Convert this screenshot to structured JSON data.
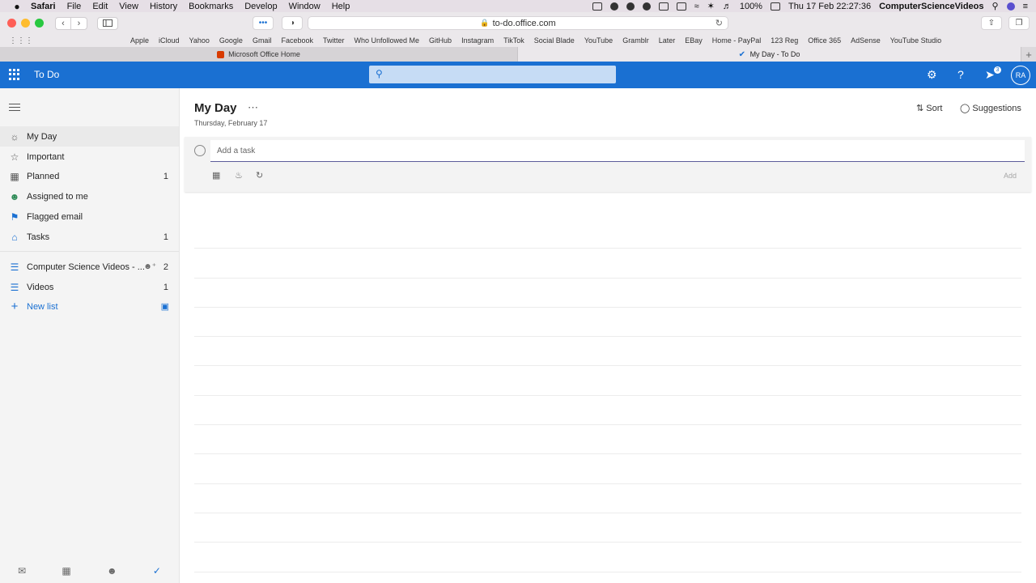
{
  "menubar": {
    "apple": "",
    "app": "Safari",
    "items": [
      "File",
      "Edit",
      "View",
      "History",
      "Bookmarks",
      "Develop",
      "Window",
      "Help"
    ],
    "battery": "100%",
    "datetime": "Thu 17 Feb  22:27:36",
    "user": "ComputerScienceVideos"
  },
  "browser": {
    "url": "to-do.office.com",
    "bookmarks": [
      "Apple",
      "iCloud",
      "Yahoo",
      "Google",
      "Gmail",
      "Facebook",
      "Twitter",
      "Who Unfollowed Me",
      "GitHub",
      "Instagram",
      "TikTok",
      "Social Blade",
      "YouTube",
      "Gramblr",
      "Later",
      "EBay",
      "Home - PayPal",
      "123 Reg",
      "Office 365",
      "AdSense",
      "YouTube Studio"
    ],
    "tabs": [
      {
        "label": "Microsoft Office Home"
      },
      {
        "label": "My Day - To Do"
      }
    ]
  },
  "app": {
    "title": "To Do",
    "badge_count": "3",
    "avatar_initials": "RA",
    "accent": "#1a70d2"
  },
  "sidebar": {
    "items": [
      {
        "label": "My Day",
        "count": ""
      },
      {
        "label": "Important",
        "count": ""
      },
      {
        "label": "Planned",
        "count": "1"
      },
      {
        "label": "Assigned to me",
        "count": ""
      },
      {
        "label": "Flagged email",
        "count": ""
      },
      {
        "label": "Tasks",
        "count": "1"
      }
    ],
    "lists": [
      {
        "label": "Computer Science Videos - ...",
        "count": "2"
      },
      {
        "label": "Videos",
        "count": "1"
      }
    ],
    "new_list": "New list"
  },
  "main": {
    "title": "My Day",
    "date": "Thursday, February 17",
    "sort_label": "Sort",
    "suggestions_label": "Suggestions",
    "add_task_placeholder": "Add a task",
    "add_button": "Add"
  }
}
